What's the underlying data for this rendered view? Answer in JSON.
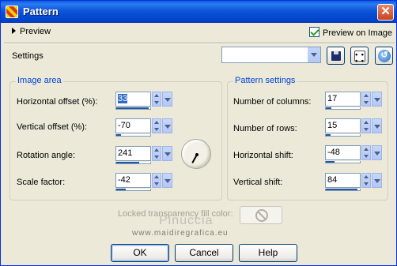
{
  "window": {
    "title": "Pattern",
    "close_label": "✕"
  },
  "preview": {
    "toggle_label": "Preview",
    "checkbox_label": "Preview on Image",
    "checked": true
  },
  "settings": {
    "label": "Settings",
    "preset_value": ""
  },
  "image_area": {
    "title": "Image area",
    "rows": [
      {
        "label": "Horizontal offset (%):",
        "value": "33",
        "fill": 0.95,
        "selected": true
      },
      {
        "label": "Vertical offset (%):",
        "value": "-70",
        "fill": 0.15
      },
      {
        "label": "Rotation angle:",
        "value": "241",
        "fill": 0.67
      },
      {
        "label": "Scale factor:",
        "value": "-42",
        "fill": 0.29
      }
    ]
  },
  "pattern_settings": {
    "title": "Pattern settings",
    "rows": [
      {
        "label": "Number of columns:",
        "value": "17",
        "fill": 0.16
      },
      {
        "label": "Number of rows:",
        "value": "15",
        "fill": 0.14
      },
      {
        "label": "Horizontal shift:",
        "value": "-48",
        "fill": 0.26
      },
      {
        "label": "Vertical shift:",
        "value": "84",
        "fill": 0.92
      }
    ]
  },
  "rotation_dial": {
    "angle": 241
  },
  "transparency": {
    "label": "Locked transparency fill color:"
  },
  "watermark": {
    "name": "Pinuccia",
    "site": "www.maidiregrafica.eu"
  },
  "buttons": {
    "ok": "OK",
    "cancel": "Cancel",
    "help": "Help"
  },
  "colors": {
    "title_bar": "#0054e3",
    "group_title": "#0046d5",
    "dialog_bg": "#ece9d8",
    "selection": "#316ac5"
  },
  "icons": {
    "save": "floppy-disk-icon",
    "randomize": "dice-icon",
    "reset": "reset-icon"
  }
}
